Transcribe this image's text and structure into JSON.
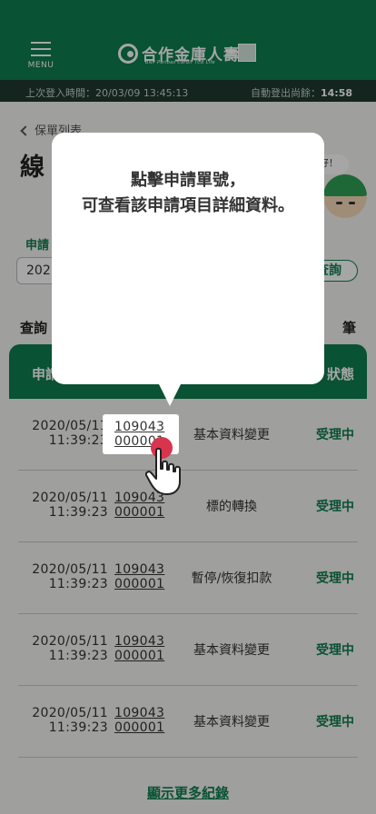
{
  "header": {
    "menu_label": "MENU",
    "logo_text": "合作金庫人壽",
    "logo_sub": "BNP Paribas Cardif TCB Life"
  },
  "statusbar": {
    "last_login": "上次登入時間：20/03/09 13:45:13",
    "auto_logout_label": "自動登出尚餘：",
    "auto_logout_time": "14:58"
  },
  "nav": {
    "back_label": "保單列表"
  },
  "page": {
    "title_fragment": "線"
  },
  "mascot": {
    "bubble": "好！"
  },
  "form": {
    "field_label": "申請",
    "field_value": "202",
    "query_button": "查詢"
  },
  "results": {
    "label": "查詢",
    "count_suffix": "筆"
  },
  "table": {
    "header_left": "申請",
    "header_right": "狀態",
    "rows": [
      {
        "date": "2020/05/11",
        "time": "11:39:23",
        "no1": "109043",
        "no2": "000001",
        "type": "基本資料變更",
        "status": "受理中"
      },
      {
        "date": "2020/05/11",
        "time": "11:39:23",
        "no1": "109043",
        "no2": "000001",
        "type": "標的轉換",
        "status": "受理中"
      },
      {
        "date": "2020/05/11",
        "time": "11:39:23",
        "no1": "109043",
        "no2": "000001",
        "type": "暫停/恢復扣款",
        "status": "受理中"
      },
      {
        "date": "2020/05/11",
        "time": "11:39:23",
        "no1": "109043",
        "no2": "000001",
        "type": "基本資料變更",
        "status": "受理中"
      },
      {
        "date": "2020/05/11",
        "time": "11:39:23",
        "no1": "109043",
        "no2": "000001",
        "type": "基本資料變更",
        "status": "受理中"
      }
    ],
    "more_link": "顯示更多紀錄"
  },
  "tooltip": {
    "line1": "點擊申請單號，",
    "line2": "可查看該申請項目詳細資料。",
    "highlight_no1": "109043",
    "highlight_no2": "000001"
  },
  "colors": {
    "brand_green": "#0e7e4f",
    "status_bar": "#1e3a2f",
    "tap_red": "#d9344d"
  },
  "icons": [
    "menu-icon",
    "chevron-left-icon",
    "logo-mark-icon",
    "hand-pointer-icon"
  ]
}
